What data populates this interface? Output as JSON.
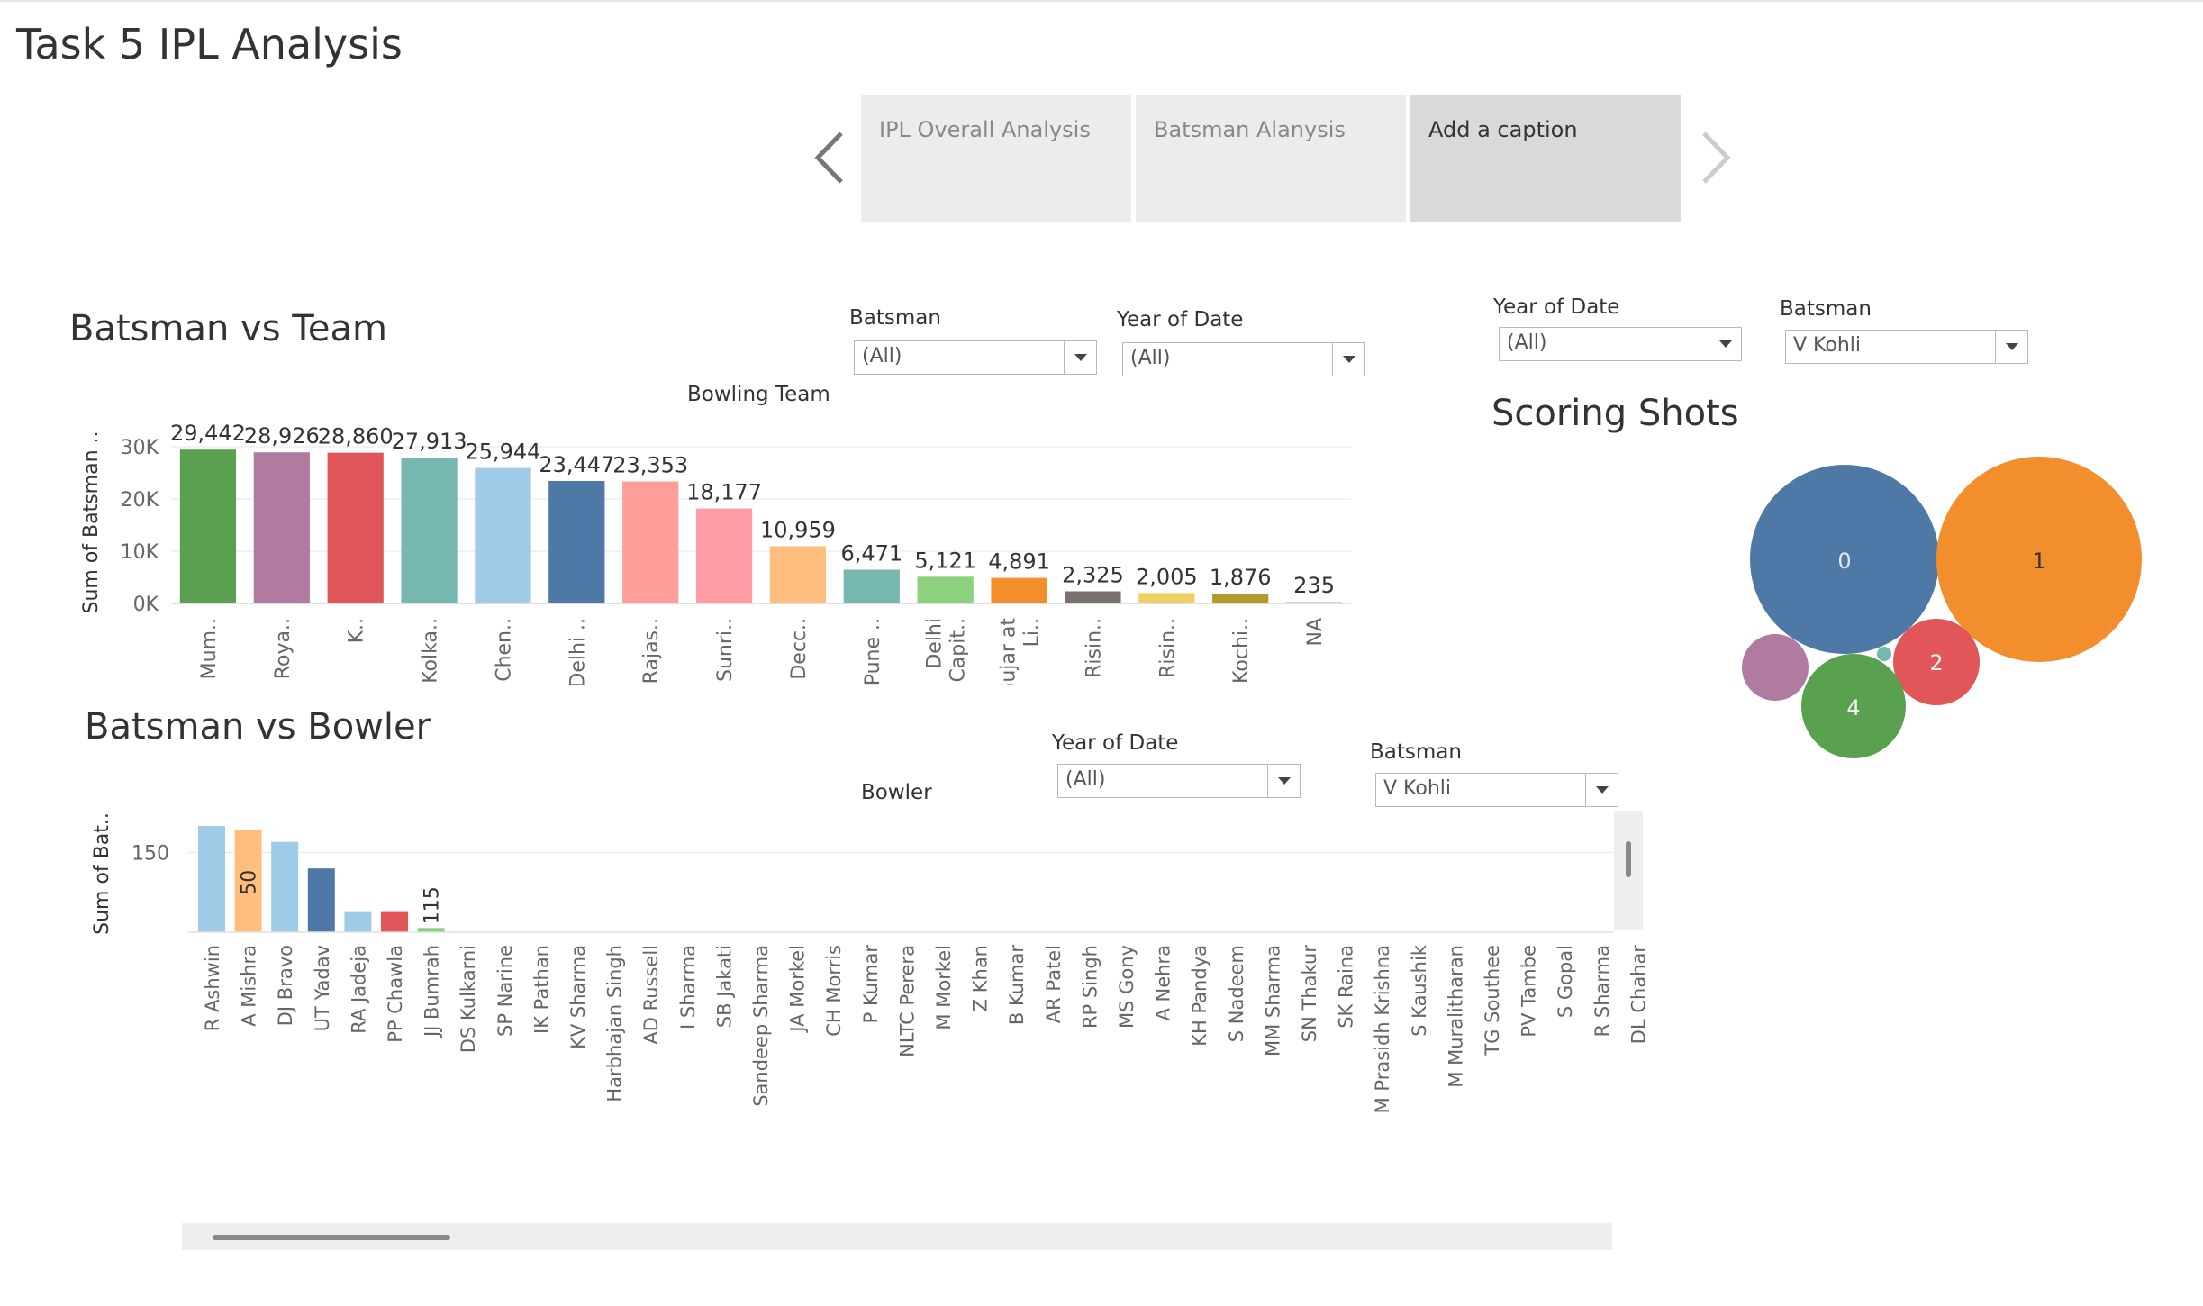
{
  "title": "Task 5 IPL Analysis",
  "story": {
    "tabs": [
      {
        "label": "IPL Overall Analysis"
      },
      {
        "label": "Batsman Alanysis"
      },
      {
        "label": "Add a caption"
      }
    ],
    "active_index": 2
  },
  "filters": {
    "team_batsman_label": "Batsman",
    "team_batsman_value": "(All)",
    "team_year_label": "Year of Date",
    "team_year_value": "(All)",
    "shots_year_label": "Year of Date",
    "shots_year_value": "(All)",
    "shots_batsman_label": "Batsman",
    "shots_batsman_value": "V Kohli",
    "bowler_year_label": "Year of Date",
    "bowler_year_value": "(All)",
    "bowler_batsman_label": "Batsman",
    "bowler_batsman_value": "V Kohli"
  },
  "colors": {
    "accent_story_active": "#d9d9d9",
    "story_tab": "#ececec"
  },
  "chart_data": [
    {
      "type": "bar",
      "title": "Batsman vs Team",
      "xlabel": "Bowling Team",
      "ylabel": "Sum of Batsman ..",
      "yticks": [
        "0K",
        "10K",
        "20K",
        "30K"
      ],
      "ylim": [
        0,
        30000
      ],
      "grid": true,
      "categories": [
        "Mum..",
        "Roya..",
        "K..",
        "Kolka..",
        "Chen..",
        "Delhi ..",
        "Rajas..",
        "Sunri..",
        "Decc..",
        "Pune ..",
        "Delhi Capit..",
        "Gujar at Li..",
        "Risin..",
        "Risin..",
        "Kochi..",
        "NA"
      ],
      "values": [
        29442,
        28926,
        28860,
        27913,
        25944,
        23447,
        23353,
        18177,
        10959,
        6471,
        5121,
        4891,
        2325,
        2005,
        1876,
        235
      ],
      "value_labels": [
        "29,442",
        "28,926",
        "28,860",
        "27,913",
        "25,944",
        "23,447",
        "23,353",
        "18,177",
        "10,959",
        "6,471",
        "5,121",
        "4,891",
        "2,325",
        "2,005",
        "1,876",
        "235"
      ],
      "colors": [
        "#59a14f",
        "#b07aa1",
        "#e15759",
        "#76b7b2",
        "#a0cbe8",
        "#4e79a7",
        "#ff9d9a",
        "#ff9da7",
        "#ffbe7d",
        "#76b7b2",
        "#8cd17d",
        "#f28e2b",
        "#7b7070",
        "#f1ce63",
        "#b6992d",
        "#d4d4d4"
      ]
    },
    {
      "type": "scatter",
      "title": "Scoring Shots",
      "bubbles": [
        {
          "label": "0",
          "color": "#4e79a7"
        },
        {
          "label": "1",
          "color": "#f28e2b"
        },
        {
          "label": "2",
          "color": "#e15759"
        },
        {
          "label": "4",
          "color": "#59a14f"
        },
        {
          "label": "",
          "color": "#b07aa1"
        },
        {
          "label": "",
          "color": "#76b7b2"
        }
      ]
    },
    {
      "type": "bar",
      "title": "Batsman vs Bowler",
      "xlabel": "Bowler",
      "ylabel": "Sum of Bat..",
      "yticks": [
        "150"
      ],
      "ylim": [
        0,
        200
      ],
      "grid": true,
      "categories": [
        "R Ashwin",
        "A Mishra",
        "DJ Bravo",
        "UT Yadav",
        "RA Jadeja",
        "PP Chawla",
        "JJ Bumrah",
        "DS Kulkarni",
        "SP Narine",
        "IK Pathan",
        "KV Sharma",
        "Harbhajan Singh",
        "AD Russell",
        "I Sharma",
        "SB Jakati",
        "Sandeep Sharma",
        "JA Morkel",
        "CH Morris",
        "P Kumar",
        "NLTC Perera",
        "M Morkel",
        "Z Khan",
        "B Kumar",
        "AR Patel",
        "RP Singh",
        "MS Gony",
        "A Nehra",
        "KH Pandya",
        "S Nadeem",
        "MM Sharma",
        "SN Thakur",
        "SK Raina",
        "M Prasidh Krishna",
        "S Kaushik",
        "M Muralitharan",
        "TG Southee",
        "PV Tambe",
        "S Gopal",
        "R Sharma",
        "DL Chahar"
      ],
      "values": [
        200,
        192,
        170,
        120,
        38,
        38,
        8
      ],
      "value_labels": [
        "",
        "50",
        "",
        "",
        "",
        "",
        "115"
      ],
      "colors": [
        "#a0cbe8",
        "#ffbe7d",
        "#a0cbe8",
        "#4e79a7",
        "#a0cbe8",
        "#e15759",
        "#8cd17d"
      ]
    }
  ]
}
